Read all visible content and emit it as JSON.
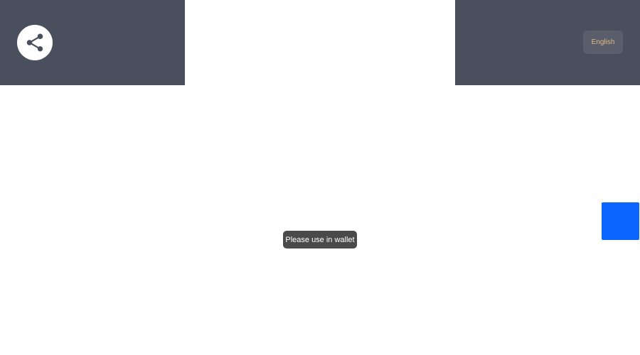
{
  "header": {
    "share_icon": "share-icon",
    "language_label": "English"
  },
  "toast": {
    "message": "Please use in wallet"
  },
  "colors": {
    "header_bg": "#4a4f5e",
    "language_text": "#e0b788",
    "toast_bg": "#4a4a4a",
    "float_button": "#0a66ff"
  }
}
